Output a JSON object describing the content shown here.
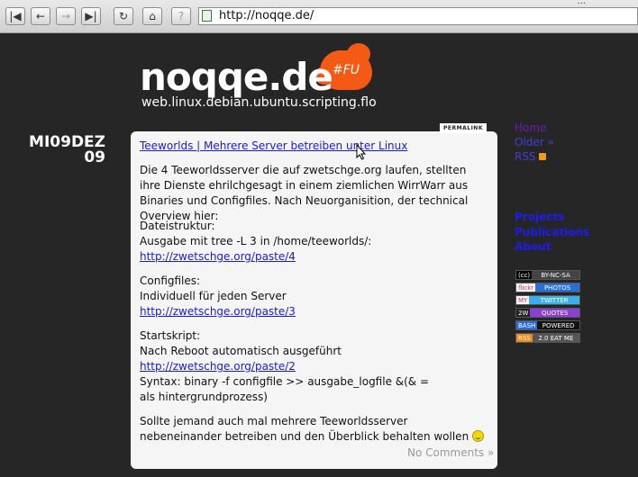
{
  "browser": {
    "url": "http://noqqe.de/",
    "buttons": {
      "first_icon": "skip-back-icon",
      "back_icon": "back-arrow-icon",
      "forward_icon": "forward-arrow-icon",
      "last_icon": "skip-forward-icon",
      "reload_icon": "reload-icon",
      "home_icon": "home-icon",
      "info_icon": "info-icon"
    }
  },
  "site": {
    "logo": "noqqe.de",
    "logo_badge": "#FU",
    "tagline": "web.linux.debian.ubuntu.scripting.flo"
  },
  "post": {
    "date_line1": "MI09DEZ",
    "date_line2": "09",
    "permalink": "PERMALINK",
    "title": "Teeworlds | Mehrere Server betreiben unter Linux",
    "intro": "Die 4 Teeworldsserver die auf zwetschge.org laufen, stellten ihre Dienste ehrilchgesagt in einem ziemlichen WirrWarr aus Binaries und Configfiles. Nach Neuorganisition, der technical Overview hier:",
    "section1_heading": "Dateistruktur:",
    "section1_text": "Ausgabe mit tree -L 3 in /home/teeworlds/:",
    "section1_link": "http://zwetschge.org/paste/4",
    "section2_heading": "Configfiles:",
    "section2_text": "Individuell für jeden Server",
    "section2_link": "http://zwetschge.org/paste/3",
    "section3_heading": "Startskript:",
    "section3_text": "Nach Reboot automatisch ausgeführt",
    "section3_link": "http://zwetschge.org/paste/2",
    "section3_syntax": "Syntax: binary -f configfile >> ausgabe_logfile &(& = als hintergrundprozess)",
    "outro": "Sollte jemand auch mal mehrere Teeworldsserver nebeneinander betreiben und den Überblick behalten wollen",
    "comments": "No Comments »"
  },
  "sidebar": {
    "home": "Home",
    "older": "Older »",
    "rss": "RSS",
    "projects": "Projects",
    "publications": "Publications",
    "about": "About",
    "badges": [
      {
        "left": "(cc)",
        "right": "BY-NC-SA",
        "lc": "#000000",
        "rc": "#444444"
      },
      {
        "left": "flickr",
        "right": "PHOTOS",
        "lc": "#ffffff",
        "rc": "#2a6fd6"
      },
      {
        "left": "MY",
        "right": "TWITTER",
        "lc": "#ffffff",
        "rc": "#3ab0ea"
      },
      {
        "left": "2W",
        "right": "QUOTES",
        "lc": "#222222",
        "rc": "#8b3fd4"
      },
      {
        "left": "BASH",
        "right": "POWERED",
        "lc": "#2b6cd8",
        "rc": "#111111"
      },
      {
        "left": "RSS",
        "right": "2.0 EAT ME",
        "lc": "#f08a1a",
        "rc": "#555555"
      }
    ]
  }
}
